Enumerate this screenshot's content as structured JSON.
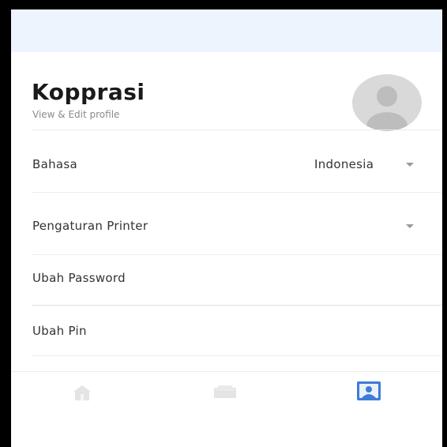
{
  "profile": {
    "name": "Kopprasi",
    "subtitle": "View & Edit profile"
  },
  "settings": {
    "language_label": "Bahasa",
    "language_value": "Indonesia",
    "printer_label": "Pengaturan Printer",
    "change_password_label": "Ubah Password",
    "change_pin_label": "Ubah Pin"
  },
  "bottom_nav": {
    "items": [
      {
        "icon": "home-icon",
        "active": false
      },
      {
        "icon": "wallet-icon",
        "active": false
      },
      {
        "icon": "profile-icon",
        "active": true
      }
    ],
    "active_color": "#3f7bd6",
    "inactive_color": "#e2e2e2"
  }
}
